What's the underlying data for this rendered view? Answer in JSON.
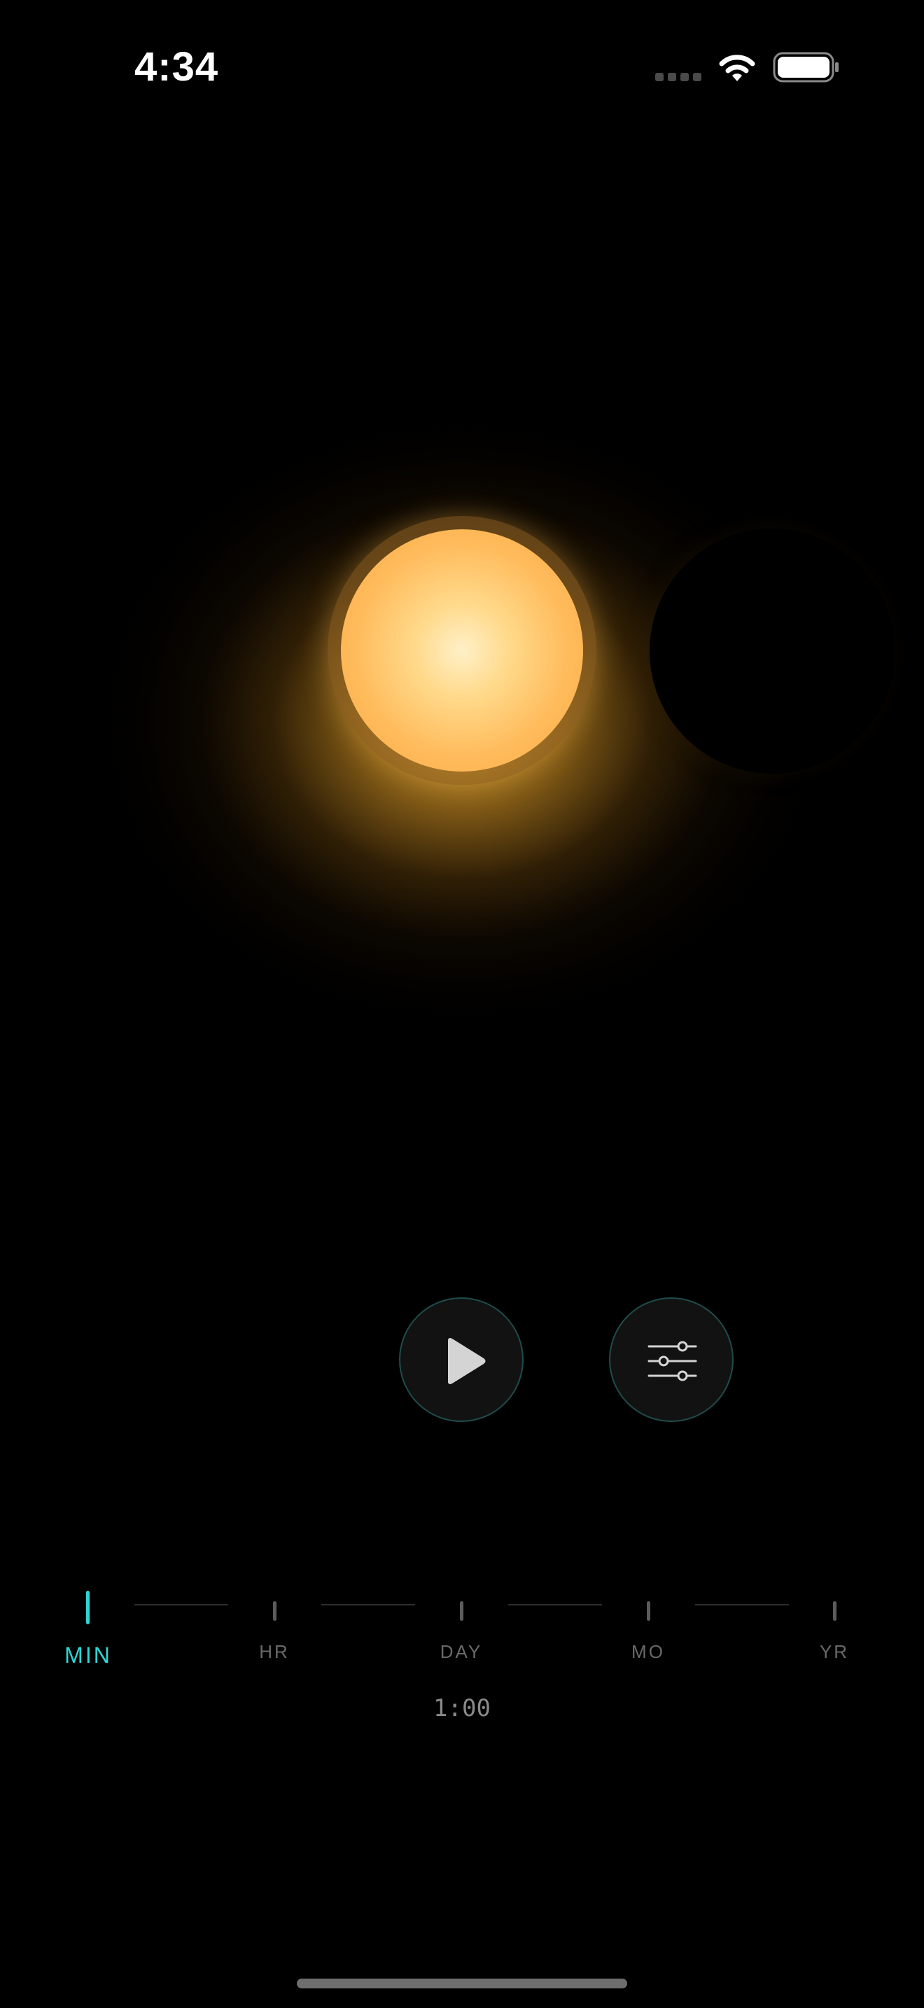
{
  "status_bar": {
    "time": "4:34",
    "signal_icon": "cellular-signal-icon",
    "wifi_icon": "wifi-icon",
    "battery_icon": "battery-icon"
  },
  "scene": {
    "sun_icon": "sun",
    "moon_icon": "eclipse-moon",
    "colors": {
      "sun_core": "#fff0c8",
      "sun_edge": "#fcaa45",
      "glow": "#e6a028"
    }
  },
  "controls": {
    "play_icon": "play-icon",
    "settings_icon": "sliders-icon",
    "button_border_color": "#1f4c4c"
  },
  "timescale": {
    "options": [
      {
        "label": "MIN",
        "active": true
      },
      {
        "label": "HR",
        "active": false
      },
      {
        "label": "DAY",
        "active": false
      },
      {
        "label": "MO",
        "active": false
      },
      {
        "label": "YR",
        "active": false
      }
    ],
    "selected": "MIN",
    "accent_color": "#2fd6d6",
    "duration": "1:00"
  }
}
